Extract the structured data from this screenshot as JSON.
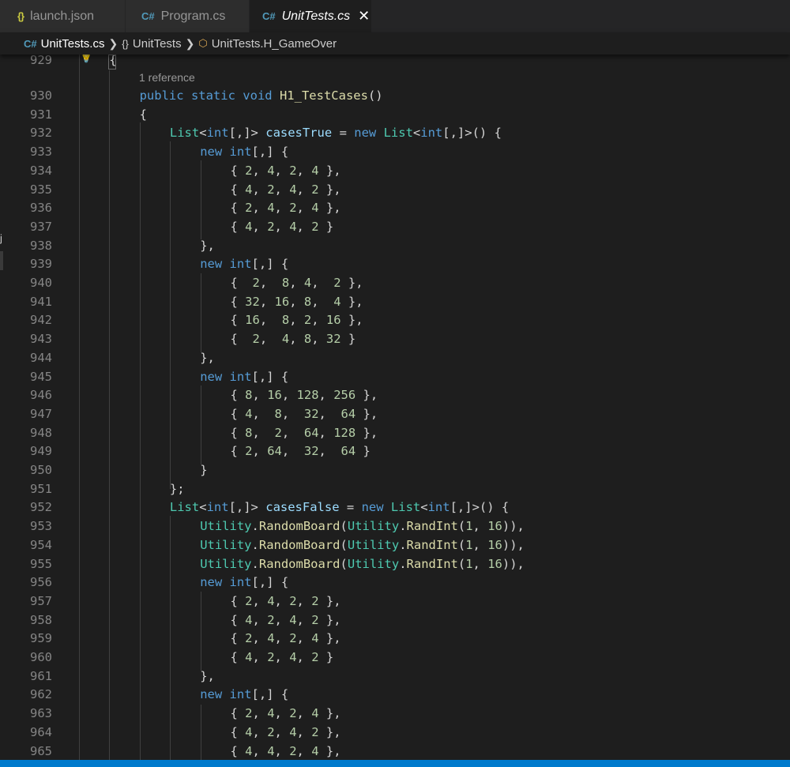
{
  "tabs": [
    {
      "label": "launch.json",
      "icon": "json-braces-icon",
      "active": false
    },
    {
      "label": "Program.cs",
      "icon": "csharp-file-icon",
      "active": false
    },
    {
      "label": "UnitTests.cs",
      "icon": "csharp-file-icon",
      "active": true,
      "close": "✕"
    }
  ],
  "breadcrumb": {
    "file": "UnitTests.cs",
    "namespace": "UnitTests",
    "symbol": "UnitTests.H_GameOver"
  },
  "editor": {
    "codelens": "1 reference",
    "lines": [
      {
        "n": "929",
        "text": "{"
      },
      {
        "n": "930",
        "text": "public static void H1_TestCases()"
      },
      {
        "n": "931",
        "text": "{"
      },
      {
        "n": "932",
        "text": "List<int[,]> casesTrue = new List<int[,]>() {"
      },
      {
        "n": "933",
        "text": "new int[,] {"
      },
      {
        "n": "934",
        "text": "{ 2, 4, 2, 4 },"
      },
      {
        "n": "935",
        "text": "{ 4, 2, 4, 2 },"
      },
      {
        "n": "936",
        "text": "{ 2, 4, 2, 4 },"
      },
      {
        "n": "937",
        "text": "{ 4, 2, 4, 2 }"
      },
      {
        "n": "938",
        "text": "},"
      },
      {
        "n": "939",
        "text": "new int[,] {"
      },
      {
        "n": "940",
        "text": "{  2,  8, 4,  2 },"
      },
      {
        "n": "941",
        "text": "{ 32, 16, 8,  4 },"
      },
      {
        "n": "942",
        "text": "{ 16,  8, 2, 16 },"
      },
      {
        "n": "943",
        "text": "{  2,  4, 8, 32 }"
      },
      {
        "n": "944",
        "text": "},"
      },
      {
        "n": "945",
        "text": "new int[,] {"
      },
      {
        "n": "946",
        "text": "{ 8, 16, 128, 256 },"
      },
      {
        "n": "947",
        "text": "{ 4,  8,  32,  64 },"
      },
      {
        "n": "948",
        "text": "{ 8,  2,  64, 128 },"
      },
      {
        "n": "949",
        "text": "{ 2, 64,  32,  64 }"
      },
      {
        "n": "950",
        "text": "}"
      },
      {
        "n": "951",
        "text": "};"
      },
      {
        "n": "952",
        "text": "List<int[,]> casesFalse = new List<int[,]>() {"
      },
      {
        "n": "953",
        "text": "Utility.RandomBoard(Utility.RandInt(1, 16)),"
      },
      {
        "n": "954",
        "text": "Utility.RandomBoard(Utility.RandInt(1, 16)),"
      },
      {
        "n": "955",
        "text": "Utility.RandomBoard(Utility.RandInt(1, 16)),"
      },
      {
        "n": "956",
        "text": "new int[,] {"
      },
      {
        "n": "957",
        "text": "{ 2, 4, 2, 2 },"
      },
      {
        "n": "958",
        "text": "{ 4, 2, 4, 2 },"
      },
      {
        "n": "959",
        "text": "{ 2, 4, 2, 4 },"
      },
      {
        "n": "960",
        "text": "{ 4, 2, 4, 2 }"
      },
      {
        "n": "961",
        "text": "},"
      },
      {
        "n": "962",
        "text": "new int[,] {"
      },
      {
        "n": "963",
        "text": "{ 2, 4, 2, 4 },"
      },
      {
        "n": "964",
        "text": "{ 4, 2, 4, 2 },"
      },
      {
        "n": "965",
        "text": "{ 4, 4, 2, 4 },"
      }
    ]
  },
  "gutter_glyph": "j",
  "colors": {
    "background": "#1e1e1e",
    "keyword": "#569cd6",
    "type": "#4ec9b0",
    "number": "#b5cea8",
    "function": "#dcdcaa",
    "identifier": "#9cdcfe",
    "statusbar": "#007acc"
  }
}
